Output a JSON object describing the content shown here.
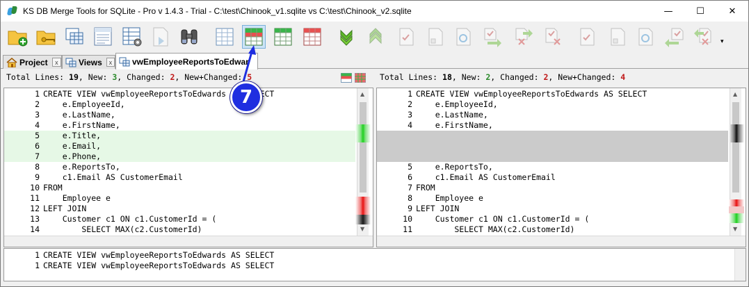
{
  "window": {
    "title": "KS DB Merge Tools for SQLite - Pro v 1.4.3 - Trial - C:\\test\\Chinook_v1.sqlite vs C:\\test\\Chinook_v2.sqlite",
    "min_label": "—",
    "max_label": "☐",
    "close_label": "✕"
  },
  "toolbar": {
    "more_label": "▾"
  },
  "tabs": [
    {
      "label": "Project",
      "close": "x"
    },
    {
      "label": "Views",
      "close": "x"
    },
    {
      "label": "vwEmployeeReportsToEdwar"
    }
  ],
  "stats": {
    "left": {
      "total_label": "Total Lines: ",
      "total": "19",
      "new_label": ", New: ",
      "new": "3",
      "changed_label": ", Changed: ",
      "changed": "2",
      "nc_label": ", New+Changed: ",
      "nc": "5"
    },
    "right": {
      "total_label": "Total Lines: ",
      "total": "18",
      "new_label": ", New: ",
      "new": "2",
      "changed_label": ", Changed: ",
      "changed": "2",
      "nc_label": ", New+Changed: ",
      "nc": "4"
    }
  },
  "left_code": [
    {
      "n": "1",
      "t": "CREATE VIEW vwEmployeeReportsToEdwards AS SELECT"
    },
    {
      "n": "2",
      "t": "    e.EmployeeId,"
    },
    {
      "n": "3",
      "t": "    e.LastName,"
    },
    {
      "n": "4",
      "t": "    e.FirstName,"
    },
    {
      "n": "5",
      "t": "    e.Title,"
    },
    {
      "n": "6",
      "t": "    e.Email,"
    },
    {
      "n": "7",
      "t": "    e.Phone,"
    },
    {
      "n": "8",
      "t": "    e.ReportsTo,"
    },
    {
      "n": "9",
      "t": "    c1.Email AS CustomerEmail"
    },
    {
      "n": "10",
      "t": "FROM"
    },
    {
      "n": "11",
      "t": "    Employee e"
    },
    {
      "n": "12",
      "t": "LEFT JOIN"
    },
    {
      "n": "13",
      "t": "    Customer c1 ON c1.CustomerId = ("
    },
    {
      "n": "14",
      "t": "        SELECT MAX(c2.CustomerId)"
    }
  ],
  "right_code": [
    {
      "n": "1",
      "t": "CREATE VIEW vwEmployeeReportsToEdwards AS SELECT"
    },
    {
      "n": "2",
      "t": "    e.EmployeeId,"
    },
    {
      "n": "3",
      "t": "    e.LastName,"
    },
    {
      "n": "4",
      "t": "    e.FirstName,"
    },
    {
      "n": "5",
      "t": "    e.ReportsTo,"
    },
    {
      "n": "6",
      "t": "    c1.Email AS CustomerEmail"
    },
    {
      "n": "7",
      "t": "FROM"
    },
    {
      "n": "8",
      "t": "    Employee e"
    },
    {
      "n": "9",
      "t": "LEFT JOIN"
    },
    {
      "n": "10",
      "t": "    Customer c1 ON c1.CustomerId = ("
    },
    {
      "n": "11",
      "t": "        SELECT MAX(c2.CustomerId)"
    }
  ],
  "bottom_code": [
    {
      "n": "1",
      "t": "CREATE VIEW vwEmployeeReportsToEdwards AS SELECT"
    },
    {
      "n": "1",
      "t": "CREATE VIEW vwEmployeeReportsToEdwards AS SELECT"
    }
  ],
  "callout": {
    "number": "7"
  },
  "colors": {
    "added_bg": "#e6f8e6",
    "placeholder_bg": "#cbcbcb",
    "new_count": "#2a8a2a",
    "changed_count": "#c01818",
    "callout": "#1f2ee0"
  }
}
